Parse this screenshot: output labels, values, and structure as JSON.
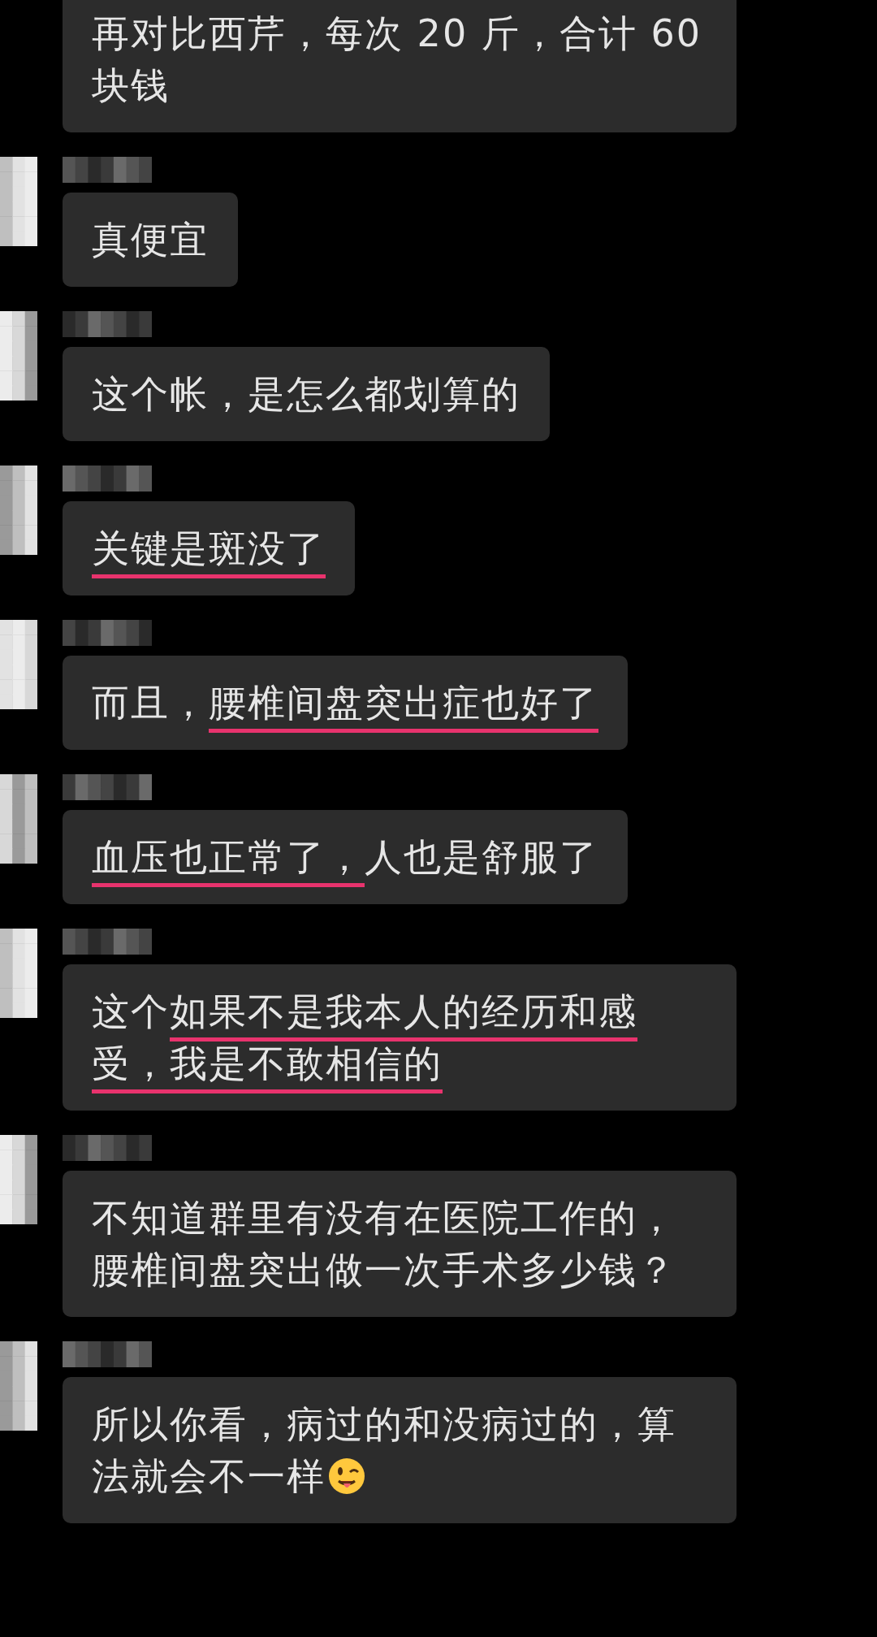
{
  "messages": [
    {
      "show_sender": false,
      "segments": [
        {
          "text": "再对比西芹，每次 20 斤，合计 60 块钱",
          "underlined": false
        }
      ]
    },
    {
      "show_sender": true,
      "segments": [
        {
          "text": "真便宜",
          "underlined": false
        }
      ]
    },
    {
      "show_sender": true,
      "segments": [
        {
          "text": "这个帐，是怎么都划算的",
          "underlined": false
        }
      ]
    },
    {
      "show_sender": true,
      "segments": [
        {
          "text": "关键是斑没了",
          "underlined": true
        }
      ]
    },
    {
      "show_sender": true,
      "segments": [
        {
          "text": "而且，",
          "underlined": false
        },
        {
          "text": "腰椎间盘突出症也好了",
          "underlined": true
        }
      ]
    },
    {
      "show_sender": true,
      "segments": [
        {
          "text": "血压也正常了，",
          "underlined": true
        },
        {
          "text": "人也是舒服了",
          "underlined": false
        }
      ]
    },
    {
      "show_sender": true,
      "segments": [
        {
          "text": "这个",
          "underlined": false
        },
        {
          "text": "如果不是我本人的经历和感受，我是不敢相信的",
          "underlined": true
        }
      ]
    },
    {
      "show_sender": true,
      "segments": [
        {
          "text": "不知道群里有没有在医院工作的，腰椎间盘突出做一次手术多少钱？",
          "underlined": false
        }
      ]
    },
    {
      "show_sender": true,
      "ends_with_emoji": true,
      "segments": [
        {
          "text": "所以你看，病过的和没病过的，算法就会不一样",
          "underlined": false
        }
      ]
    }
  ]
}
